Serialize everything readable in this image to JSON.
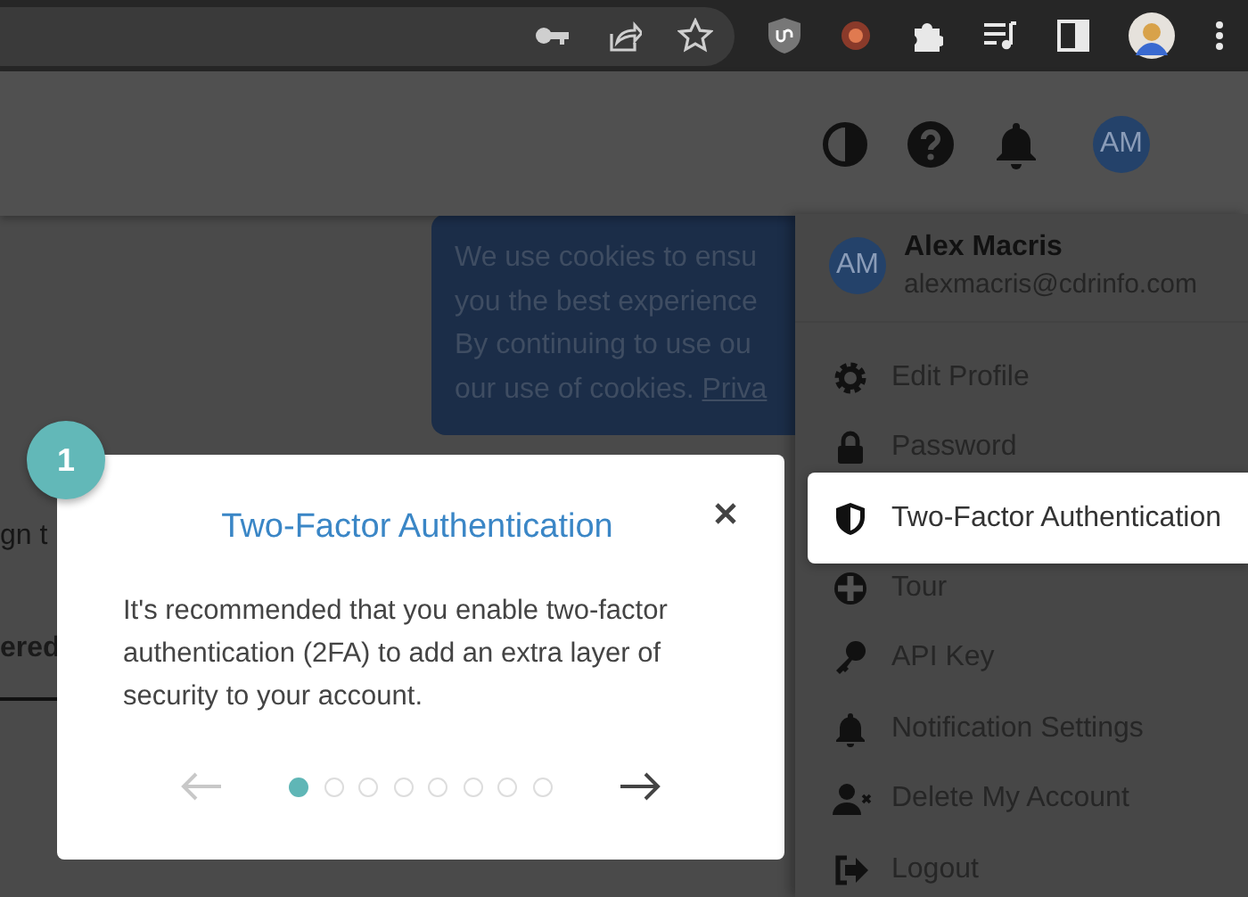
{
  "top_bar": {
    "avatar_initials": "AM"
  },
  "cookie_banner": {
    "lines": [
      "We use cookies to ensu",
      "you the best experience",
      "By continuing to use ou",
      "our use of cookies. "
    ],
    "link": "Priva"
  },
  "background_texts": [
    "gn t",
    "ered"
  ],
  "tour": {
    "step_badge": "1",
    "title": "Two-Factor Authentication",
    "body": "It's recommended that you enable two-factor authentication (2FA) to add an extra layer of security to your account.",
    "prev_disabled": true,
    "steps": [
      {
        "selected": true
      },
      {
        "selected": false
      },
      {
        "selected": false
      },
      {
        "selected": false
      },
      {
        "selected": false
      },
      {
        "selected": false
      },
      {
        "selected": false
      },
      {
        "selected": false
      }
    ]
  },
  "profile_menu": {
    "avatar_initials": "AM",
    "name": "Alex Macris",
    "email": "alexmacris@cdrinfo.com",
    "items": [
      {
        "label": "Edit Profile",
        "selected": false
      },
      {
        "label": "Password",
        "selected": false
      },
      {
        "label": "Two-Factor Authentication",
        "selected": true
      },
      {
        "label": "Tour",
        "selected": false
      },
      {
        "label": "API Key",
        "selected": false
      },
      {
        "label": "Notification Settings",
        "selected": false
      },
      {
        "label": "Delete My Account",
        "selected": false
      },
      {
        "label": "Logout",
        "selected": false
      }
    ]
  }
}
